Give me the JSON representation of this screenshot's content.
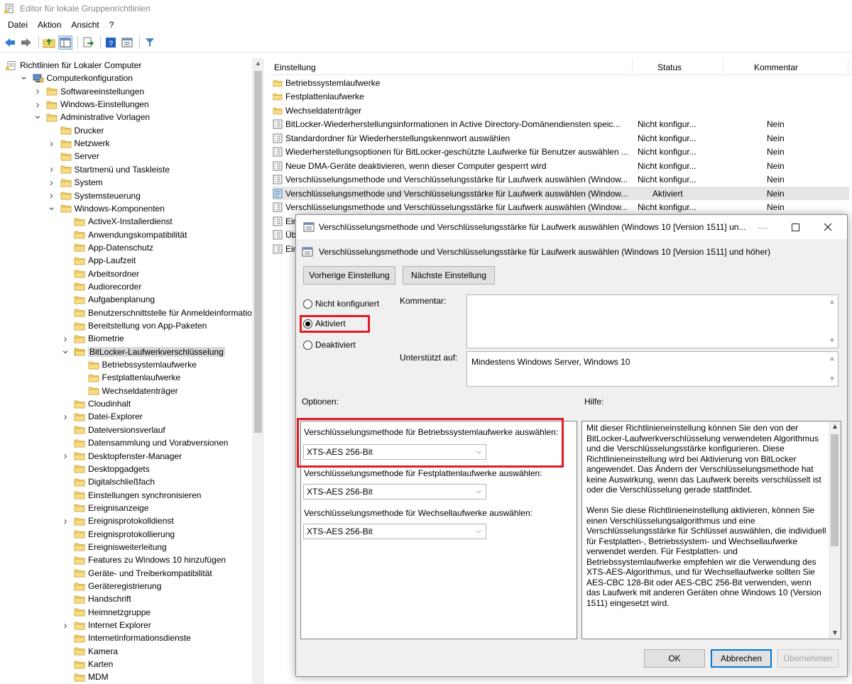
{
  "window": {
    "title": "Editor für lokale Gruppenrichtlinien"
  },
  "menu": [
    "Datei",
    "Aktion",
    "Ansicht",
    "?"
  ],
  "tree": [
    {
      "label": "Richtlinien für Lokaler Computer",
      "indent": 0,
      "chev": "",
      "icon": "policy-icon"
    },
    {
      "label": "Computerkonfiguration",
      "indent": 1,
      "chev": "open",
      "icon": "computer-icon"
    },
    {
      "label": "Softwareeinstellungen",
      "indent": 2,
      "chev": "closed",
      "icon": "folder-icon"
    },
    {
      "label": "Windows-Einstellungen",
      "indent": 2,
      "chev": "closed",
      "icon": "folder-icon"
    },
    {
      "label": "Administrative Vorlagen",
      "indent": 2,
      "chev": "open",
      "icon": "folder-icon"
    },
    {
      "label": "Drucker",
      "indent": 3,
      "chev": "",
      "icon": "folder-icon"
    },
    {
      "label": "Netzwerk",
      "indent": 3,
      "chev": "closed",
      "icon": "folder-icon"
    },
    {
      "label": "Server",
      "indent": 3,
      "chev": "",
      "icon": "folder-icon"
    },
    {
      "label": "Startmenü und Taskleiste",
      "indent": 3,
      "chev": "closed",
      "icon": "folder-icon"
    },
    {
      "label": "System",
      "indent": 3,
      "chev": "closed",
      "icon": "folder-icon"
    },
    {
      "label": "Systemsteuerung",
      "indent": 3,
      "chev": "closed",
      "icon": "folder-icon"
    },
    {
      "label": "Windows-Komponenten",
      "indent": 3,
      "chev": "open",
      "icon": "folder-icon"
    },
    {
      "label": "ActiveX-Installerdienst",
      "indent": 4,
      "chev": "",
      "icon": "folder-icon"
    },
    {
      "label": "Anwendungskompatibilität",
      "indent": 4,
      "chev": "",
      "icon": "folder-icon"
    },
    {
      "label": "App-Datenschutz",
      "indent": 4,
      "chev": "",
      "icon": "folder-icon"
    },
    {
      "label": "App-Laufzeit",
      "indent": 4,
      "chev": "",
      "icon": "folder-icon"
    },
    {
      "label": "Arbeitsordner",
      "indent": 4,
      "chev": "",
      "icon": "folder-icon"
    },
    {
      "label": "Audiorecorder",
      "indent": 4,
      "chev": "",
      "icon": "folder-icon"
    },
    {
      "label": "Aufgabenplanung",
      "indent": 4,
      "chev": "",
      "icon": "folder-icon"
    },
    {
      "label": "Benutzerschnittstelle für Anmeldeinformation",
      "indent": 4,
      "chev": "",
      "icon": "folder-icon"
    },
    {
      "label": "Bereitstellung von App-Paketen",
      "indent": 4,
      "chev": "",
      "icon": "folder-icon"
    },
    {
      "label": "Biometrie",
      "indent": 4,
      "chev": "closed",
      "icon": "folder-icon"
    },
    {
      "label": "BitLocker-Laufwerkverschlüsselung",
      "indent": 4,
      "chev": "open",
      "icon": "folder-open-icon",
      "selected": true
    },
    {
      "label": "Betriebssystemlaufwerke",
      "indent": 5,
      "chev": "",
      "icon": "folder-icon"
    },
    {
      "label": "Festplattenlaufwerke",
      "indent": 5,
      "chev": "",
      "icon": "folder-icon"
    },
    {
      "label": "Wechseldatenträger",
      "indent": 5,
      "chev": "",
      "icon": "folder-icon"
    },
    {
      "label": "Cloudinhalt",
      "indent": 4,
      "chev": "",
      "icon": "folder-icon"
    },
    {
      "label": "Datei-Explorer",
      "indent": 4,
      "chev": "closed",
      "icon": "folder-icon"
    },
    {
      "label": "Dateiversionsverlauf",
      "indent": 4,
      "chev": "",
      "icon": "folder-icon"
    },
    {
      "label": "Datensammlung und Vorabversionen",
      "indent": 4,
      "chev": "",
      "icon": "folder-icon"
    },
    {
      "label": "Desktopfenster-Manager",
      "indent": 4,
      "chev": "closed",
      "icon": "folder-icon"
    },
    {
      "label": "Desktopgadgets",
      "indent": 4,
      "chev": "",
      "icon": "folder-icon"
    },
    {
      "label": "Digitalschließfach",
      "indent": 4,
      "chev": "",
      "icon": "folder-icon"
    },
    {
      "label": "Einstellungen synchronisieren",
      "indent": 4,
      "chev": "",
      "icon": "folder-icon"
    },
    {
      "label": "Ereignisanzeige",
      "indent": 4,
      "chev": "",
      "icon": "folder-icon"
    },
    {
      "label": "Ereignisprotokolldienst",
      "indent": 4,
      "chev": "closed",
      "icon": "folder-icon"
    },
    {
      "label": "Ereignisprotokollierung",
      "indent": 4,
      "chev": "",
      "icon": "folder-icon"
    },
    {
      "label": "Ereignisweiterleitung",
      "indent": 4,
      "chev": "",
      "icon": "folder-icon"
    },
    {
      "label": "Features zu Windows 10 hinzufügen",
      "indent": 4,
      "chev": "",
      "icon": "folder-icon"
    },
    {
      "label": "Geräte- und Treiberkompatibilität",
      "indent": 4,
      "chev": "",
      "icon": "folder-icon"
    },
    {
      "label": "Geräteregistrierung",
      "indent": 4,
      "chev": "",
      "icon": "folder-icon"
    },
    {
      "label": "Handschrift",
      "indent": 4,
      "chev": "",
      "icon": "folder-icon"
    },
    {
      "label": "Heimnetzgruppe",
      "indent": 4,
      "chev": "",
      "icon": "folder-icon"
    },
    {
      "label": "Internet Explorer",
      "indent": 4,
      "chev": "closed",
      "icon": "folder-icon"
    },
    {
      "label": "Internetinformationsdienste",
      "indent": 4,
      "chev": "",
      "icon": "folder-icon"
    },
    {
      "label": "Kamera",
      "indent": 4,
      "chev": "",
      "icon": "folder-icon"
    },
    {
      "label": "Karten",
      "indent": 4,
      "chev": "",
      "icon": "folder-icon"
    },
    {
      "label": "MDM",
      "indent": 4,
      "chev": "",
      "icon": "folder-icon"
    }
  ],
  "list": {
    "columns": {
      "setting": "Einstellung",
      "status": "Status",
      "comment": "Kommentar"
    },
    "rows": [
      {
        "name": "Betriebssystemlaufwerke",
        "status": "",
        "comment": "",
        "icon": "folder-icon"
      },
      {
        "name": "Festplattenlaufwerke",
        "status": "",
        "comment": "",
        "icon": "folder-icon"
      },
      {
        "name": "Wechseldatenträger",
        "status": "",
        "comment": "",
        "icon": "folder-icon"
      },
      {
        "name": "BitLocker-Wiederherstellungsinformationen in Active Directory-Domänendiensten speic...",
        "status": "Nicht konfigur...",
        "comment": "Nein",
        "icon": "setting-icon"
      },
      {
        "name": "Standardordner für Wiederherstellungskennwort auswählen",
        "status": "Nicht konfigur...",
        "comment": "Nein",
        "icon": "setting-icon"
      },
      {
        "name": "Wiederherstellungsoptionen für BitLocker-geschützte Laufwerke für Benutzer auswählen ...",
        "status": "Nicht konfigur...",
        "comment": "Nein",
        "icon": "setting-icon"
      },
      {
        "name": "Neue DMA-Geräte deaktivieren, wenn dieser Computer gesperrt wird",
        "status": "Nicht konfigur...",
        "comment": "Nein",
        "icon": "setting-icon"
      },
      {
        "name": "Verschlüsselungsmethode und Verschlüsselungsstärke für Laufwerk auswählen (Window...",
        "status": "Nicht konfigur...",
        "comment": "Nein",
        "icon": "setting-icon"
      },
      {
        "name": "Verschlüsselungsmethode und Verschlüsselungsstärke für Laufwerk auswählen (Window...",
        "status": "Aktiviert",
        "comment": "Nein",
        "icon": "setting-enabled-icon",
        "highlight": true
      },
      {
        "name": "Verschlüsselungsmethode und Verschlüsselungsstärke für Laufwerk auswählen (Window...",
        "status": "Nicht konfigur...",
        "comment": "Nein",
        "icon": "setting-icon"
      },
      {
        "name": "Ein",
        "status": "",
        "comment": "",
        "icon": "setting-icon"
      },
      {
        "name": "Üb",
        "status": "",
        "comment": "",
        "icon": "setting-icon"
      },
      {
        "name": "Ein",
        "status": "",
        "comment": "",
        "icon": "setting-icon"
      }
    ]
  },
  "dialog": {
    "title": "Verschlüsselungsmethode und Verschlüsselungsstärke für Laufwerk auswählen (Windows 10 [Version 1511] un...",
    "heading": "Verschlüsselungsmethode und Verschlüsselungsstärke für Laufwerk auswählen (Windows 10 [Version 1511] und höher)",
    "prev_button": "Vorherige Einstellung",
    "next_button": "Nächste Einstellung",
    "radio_not_configured": "Nicht konfiguriert",
    "radio_enabled": "Aktiviert",
    "radio_disabled": "Deaktiviert",
    "selected_radio": "Aktiviert",
    "comment_label": "Kommentar:",
    "comment_value": "",
    "supported_label": "Unterstützt auf:",
    "supported_value": "Mindestens Windows Server, Windows 10",
    "options_label": "Optionen:",
    "help_label": "Hilfe:",
    "option1_label": "Verschlüsselungsmethode für Betriebssystemlaufwerke auswählen:",
    "option1_value": "XTS-AES 256-Bit",
    "option2_label": "Verschlüsselungsmethode für Festplattenlaufwerke auswählen:",
    "option2_value": "XTS-AES 256-Bit",
    "option3_label": "Verschlüsselungsmethode für Wechsellaufwerke auswählen:",
    "option3_value": "XTS-AES 256-Bit",
    "help_p1": "Mit dieser Richtlinieneinstellung können Sie den von der BitLocker-Laufwerkverschlüsselung verwendeten Algorithmus und die Verschlüsselungsstärke konfigurieren. Diese Richtlinieneinstellung wird bei Aktivierung von BitLocker angewendet. Das Ändern der Verschlüsselungsmethode hat keine Auswirkung, wenn das Laufwerk bereits verschlüsselt ist oder die Verschlüsselung gerade stattfindet.",
    "help_p2": "Wenn Sie diese Richtlinieneinstellung aktivieren, können Sie einen Verschlüsselungsalgorithmus und eine Verschlüsselungsstärke für Schlüssel auswählen, die individuell für Festplatten-, Betriebssystem- und Wechsellaufwerke verwendet werden. Für Festplatten- und Betriebssystemlaufwerke empfehlen wir die Verwendung des XTS-AES-Algorithmus, und für Wechsellaufwerke sollten Sie AES-CBC 128-Bit oder AES-CBC 256-Bit verwenden, wenn das Laufwerk mit anderen Geräten ohne Windows 10 (Version 1511) eingesetzt wird.",
    "ok_button": "OK",
    "cancel_button": "Abbrechen",
    "apply_button": "Übernehmen"
  },
  "colors": {
    "highlight_red": "#e01b22",
    "folder": "#f4d36b",
    "accent": "#0078d7"
  }
}
